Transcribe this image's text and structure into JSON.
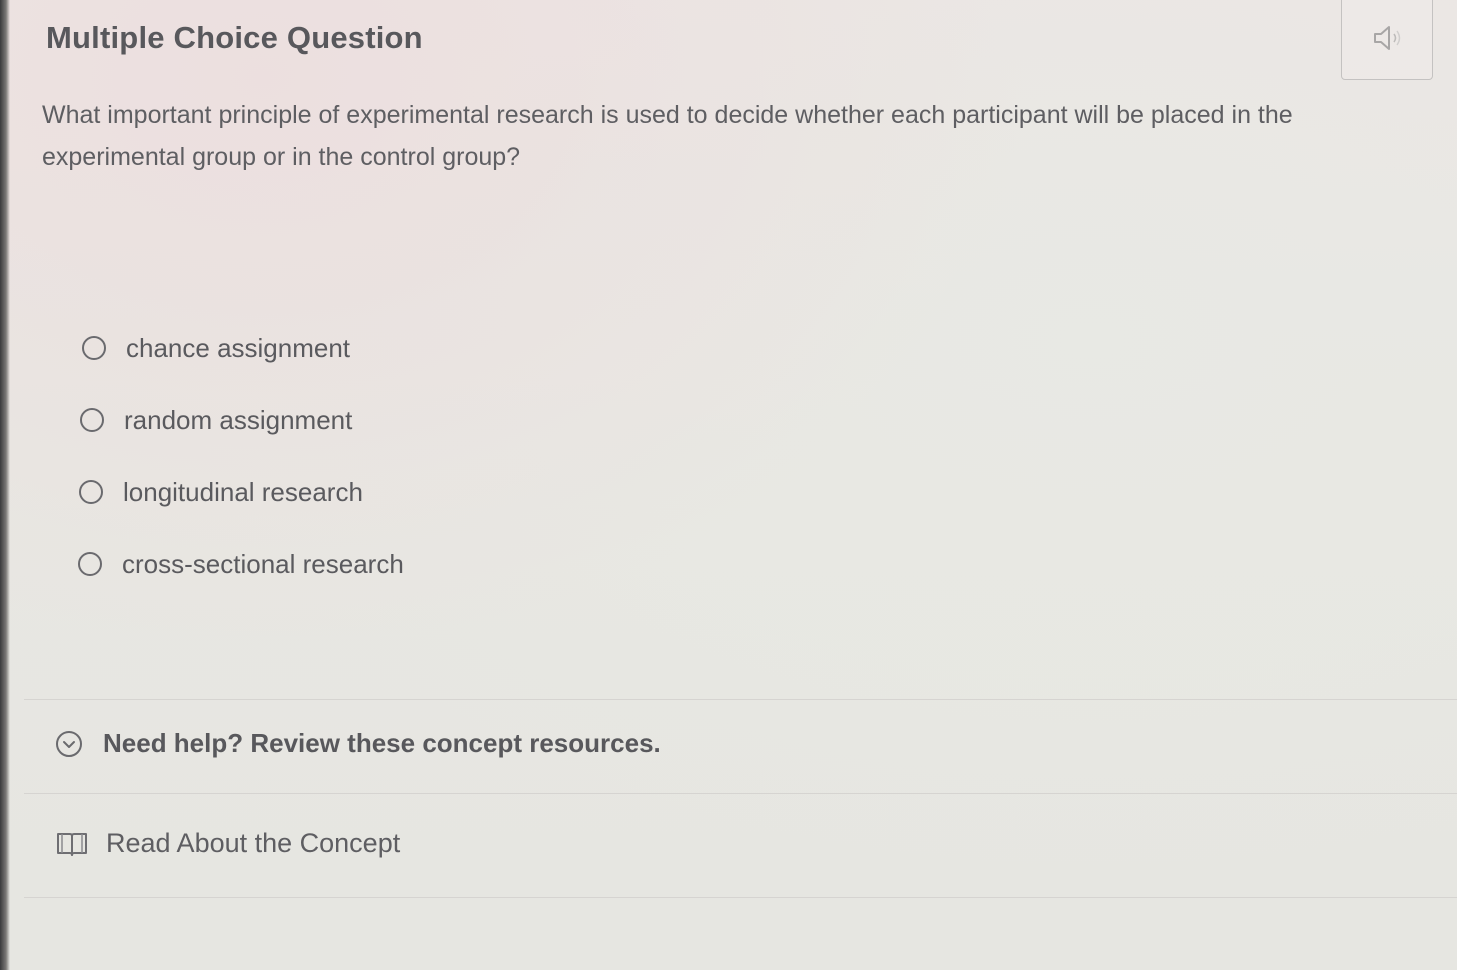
{
  "header": {
    "title": "Multiple Choice Question",
    "audio_icon": "speaker-icon"
  },
  "question": {
    "text": "What important principle of experimental research is used to decide whether each participant will be placed in the experimental group or in the control group?"
  },
  "options": [
    {
      "label": "chance assignment",
      "selected": false
    },
    {
      "label": "random assignment",
      "selected": false
    },
    {
      "label": "longitudinal research",
      "selected": false
    },
    {
      "label": "cross-sectional research",
      "selected": false
    }
  ],
  "help": {
    "label": "Need help? Review these concept resources.",
    "icon": "chevron-down-circle-icon"
  },
  "resources": [
    {
      "label": "Read About the Concept",
      "icon": "book-icon"
    }
  ]
}
